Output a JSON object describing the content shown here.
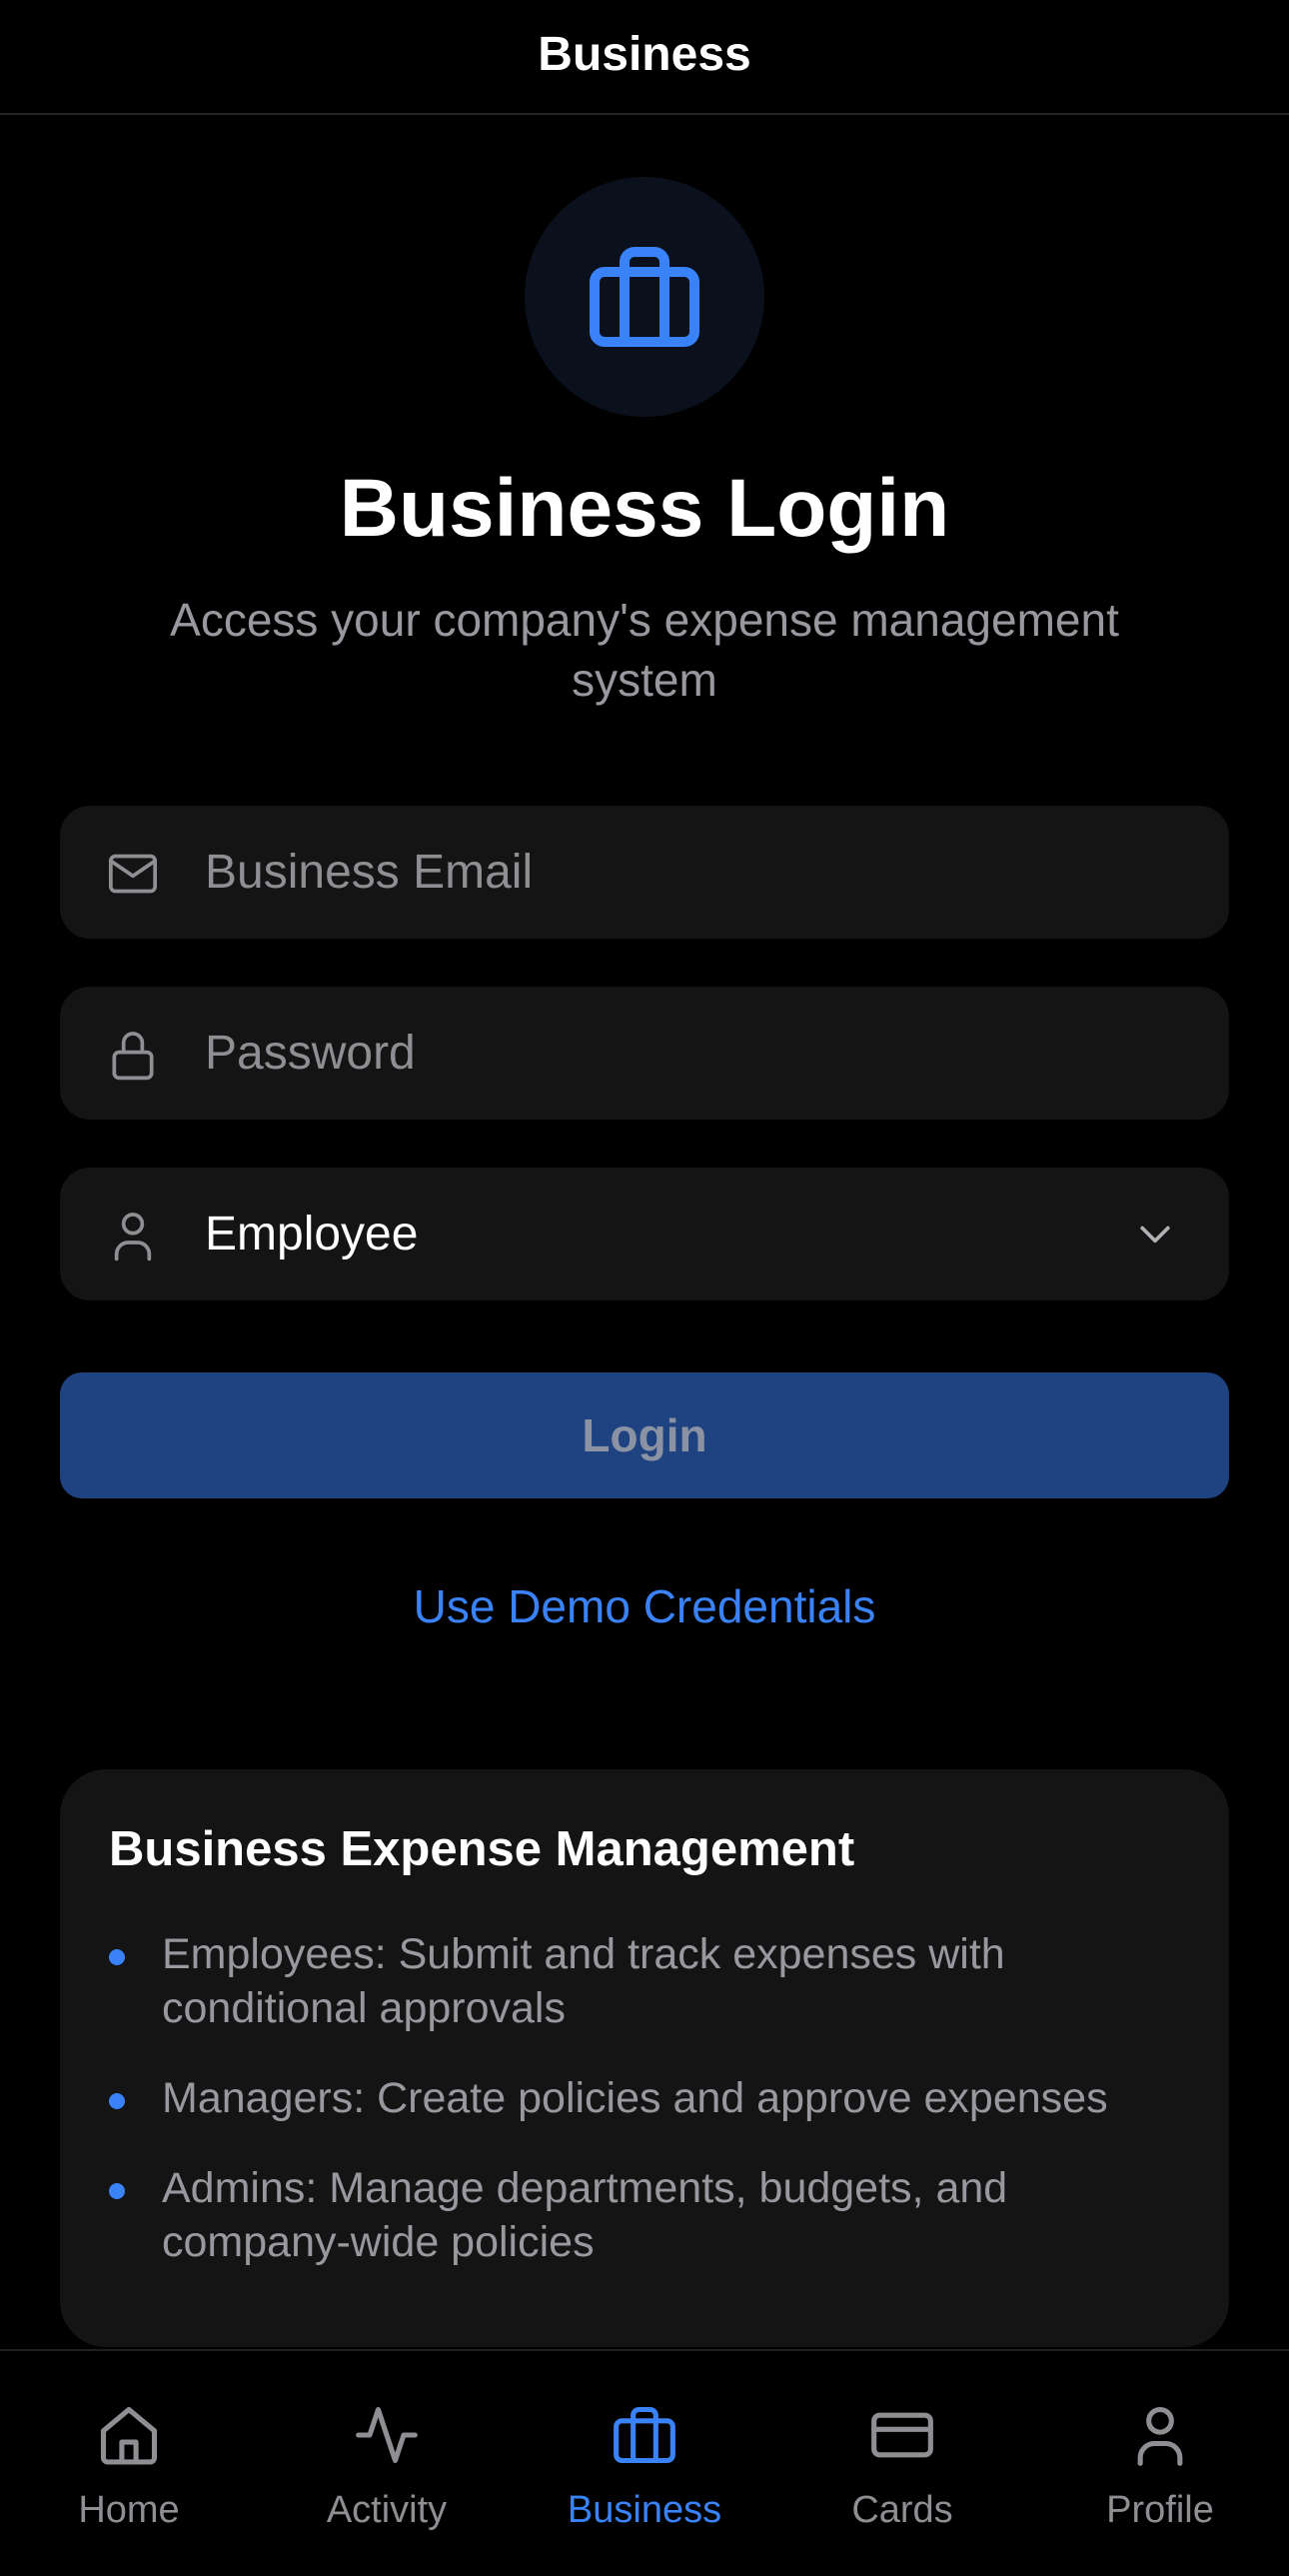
{
  "header": {
    "title": "Business"
  },
  "hero": {
    "icon": "briefcase-icon",
    "title": "Business Login",
    "subtitle": "Access your company's expense management system"
  },
  "form": {
    "email": {
      "icon": "mail-icon",
      "placeholder": "Business Email",
      "value": ""
    },
    "password": {
      "icon": "lock-icon",
      "placeholder": "Password",
      "value": ""
    },
    "role": {
      "icon": "user-icon",
      "value": "Employee",
      "chevron": "chevron-down-icon"
    },
    "login_label": "Login",
    "demo_label": "Use Demo Credentials"
  },
  "info": {
    "title": "Business Expense Management",
    "items": [
      "Employees: Submit and track expenses with conditional approvals",
      "Managers: Create policies and approve expenses",
      "Admins: Manage departments, budgets, and company-wide policies"
    ]
  },
  "tabs": [
    {
      "label": "Home",
      "icon": "home-icon",
      "active": false
    },
    {
      "label": "Activity",
      "icon": "activity-icon",
      "active": false
    },
    {
      "label": "Business",
      "icon": "briefcase-icon",
      "active": true
    },
    {
      "label": "Cards",
      "icon": "card-icon",
      "active": false
    },
    {
      "label": "Profile",
      "icon": "user-icon",
      "active": false
    }
  ],
  "colors": {
    "accent": "#3a82f7",
    "background": "#000000",
    "field_background": "#141414",
    "button_background": "#1f4280",
    "muted_text": "#98989e"
  }
}
